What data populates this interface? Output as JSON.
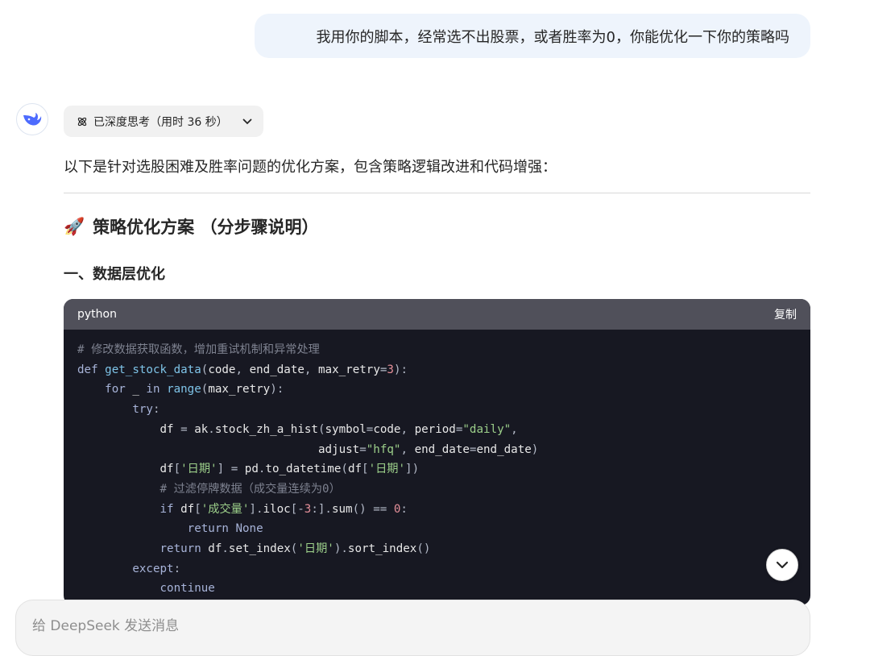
{
  "user_message": "我用你的脚本，经常选不出股票，或者胜率为0，你能优化一下你的策略吗",
  "assistant": {
    "thinking_label": "已深度思考（用时 36 秒）",
    "intro": "以下是针对选股困难及胜率问题的优化方案，包含策略逻辑改进和代码增强：",
    "heading": "策略优化方案 （分步骤说明）",
    "heading_emoji": "🚀",
    "subheading": "一、数据层优化",
    "code": {
      "language": "python",
      "copy_label": "复制",
      "lines": [
        "# 修改数据获取函数，增加重试机制和异常处理",
        "def get_stock_data(code, end_date, max_retry=3):",
        "    for _ in range(max_retry):",
        "        try:",
        "            df = ak.stock_zh_a_hist(symbol=code, period=\"daily\",",
        "                                   adjust=\"hfq\", end_date=end_date)",
        "            df['日期'] = pd.to_datetime(df['日期'])",
        "            # 过滤停牌数据（成交量连续为0）",
        "            if df['成交量'].iloc[-3:].sum() == 0:",
        "                return None",
        "            return df.set_index('日期').sort_index()",
        "        except:",
        "            continue"
      ]
    }
  },
  "input": {
    "placeholder": "给 DeepSeek 发送消息"
  },
  "colors": {
    "accent": "#4d6bfe",
    "user_bubble": "#eef4fc",
    "code_bg": "#171822",
    "code_header": "#50505a"
  },
  "icons": {
    "avatar": "deepseek-whale-icon",
    "thinking": "atom-icon",
    "expand": "chevron-down-icon",
    "scroll": "chevron-down-icon"
  }
}
